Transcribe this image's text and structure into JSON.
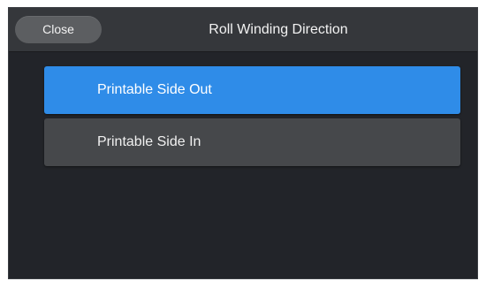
{
  "header": {
    "close_label": "Close",
    "title": "Roll Winding Direction"
  },
  "options": [
    {
      "label": "Printable Side Out",
      "selected": true
    },
    {
      "label": "Printable Side In",
      "selected": false
    }
  ],
  "colors": {
    "selected_accent": "#2f8ce8",
    "option_background": "#46484b",
    "screen_background": "#222429",
    "header_background": "#35373b"
  }
}
